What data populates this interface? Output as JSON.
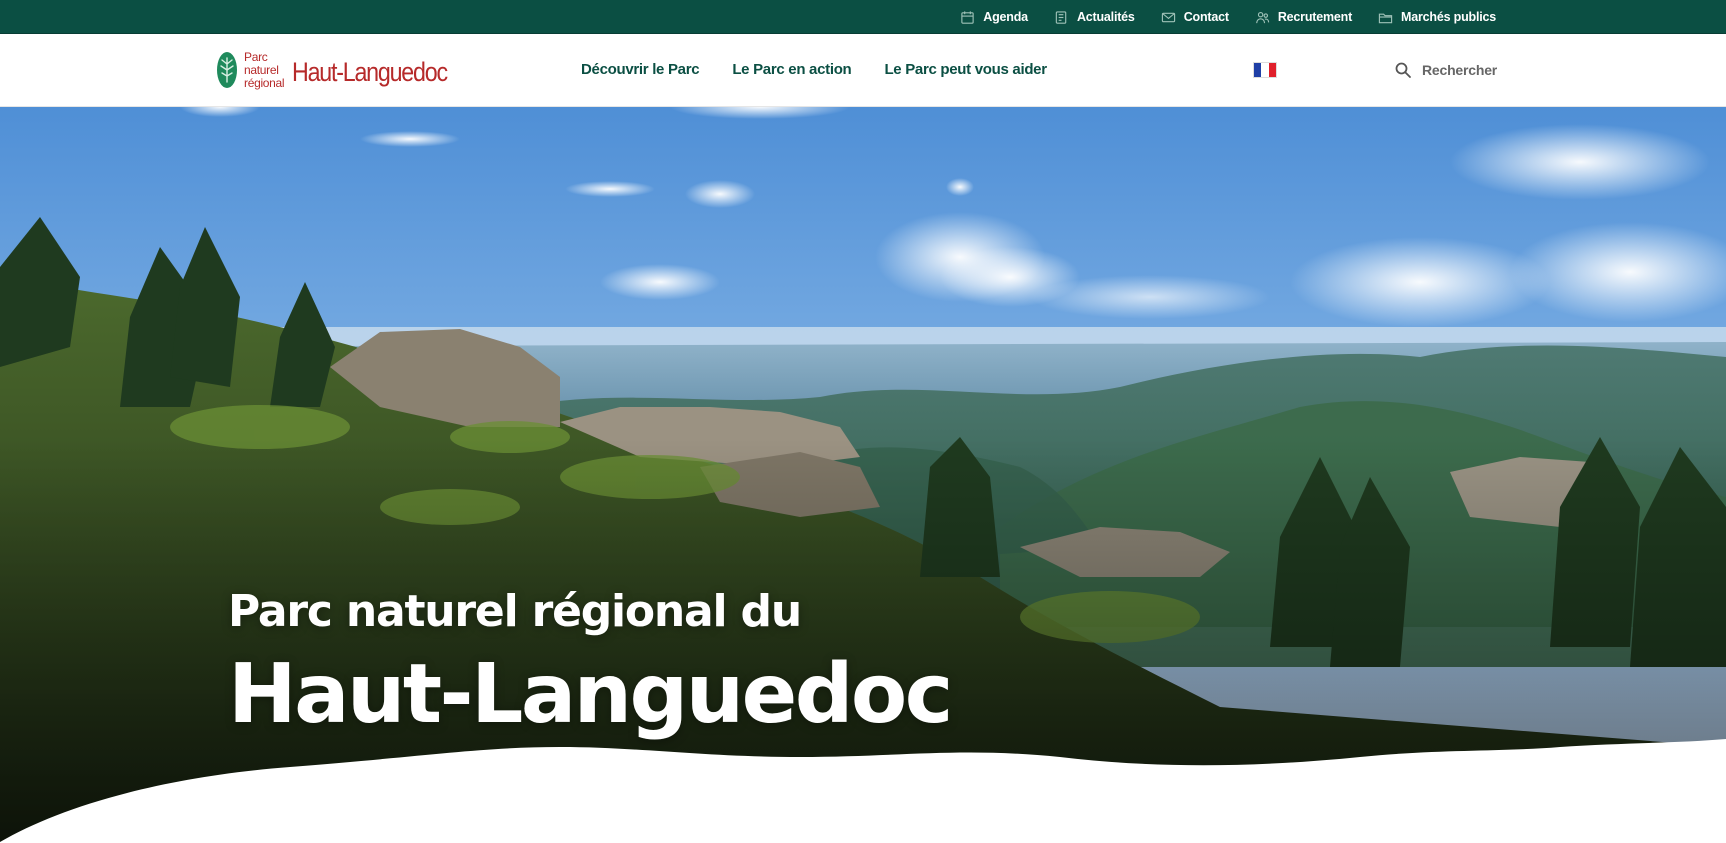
{
  "colors": {
    "brand_green": "#0b4f43",
    "brand_red": "#b62a2a",
    "header_bg": "#ffffff",
    "hero_text": "#ffffff"
  },
  "topbar": {
    "links": [
      {
        "label": "Agenda",
        "icon": "calendar-icon"
      },
      {
        "label": "Actualités",
        "icon": "news-icon"
      },
      {
        "label": "Contact",
        "icon": "envelope-icon"
      },
      {
        "label": "Recrutement",
        "icon": "people-icon"
      },
      {
        "label": "Marchés publics",
        "icon": "folder-icon"
      }
    ]
  },
  "header": {
    "logo": {
      "small_line1": "Parc",
      "small_line2": "naturel",
      "small_line3": "régional",
      "name": "Haut-Languedoc"
    },
    "nav": [
      {
        "label": "Découvrir le Parc"
      },
      {
        "label": "Le Parc en action"
      },
      {
        "label": "Le Parc peut vous aider"
      }
    ],
    "language": {
      "icon": "french-flag-icon",
      "colors": [
        "#1f3fa6",
        "#ffffff",
        "#e0202b"
      ]
    },
    "search": {
      "label": "Rechercher",
      "icon": "search-icon"
    }
  },
  "hero": {
    "title_line1": "Parc naturel régional du",
    "title_line2": "Haut-Languedoc"
  }
}
